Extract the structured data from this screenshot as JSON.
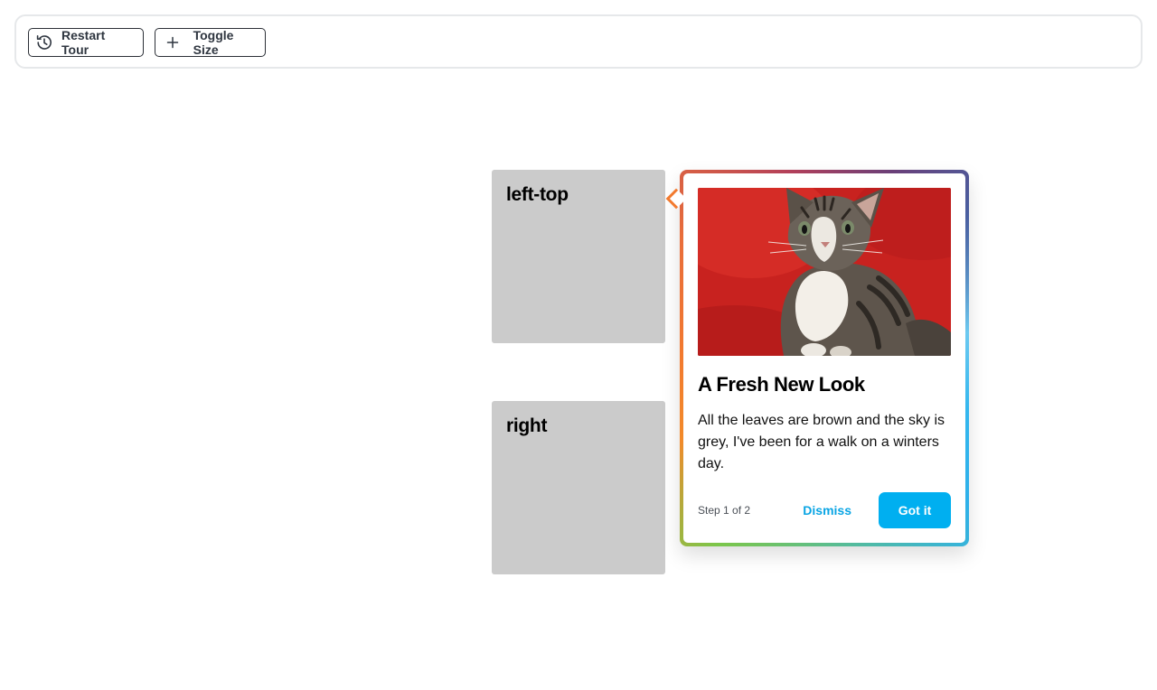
{
  "toolbar": {
    "restart_label": "Restart Tour",
    "toggle_label": "Toggle Size",
    "restart_icon": "history-icon",
    "toggle_icon": "plus-icon"
  },
  "targets": {
    "left_top_label": "left-top",
    "right_label": "right"
  },
  "tour": {
    "image": "kitten-photo",
    "title": "A Fresh New Look",
    "body": "All the leaves are brown and the sky is grey, I've been for a walk on a winters day.",
    "step": "Step 1 of 2",
    "dismiss_label": "Dismiss",
    "confirm_label": "Got it",
    "accent_color": "#00aff0"
  }
}
